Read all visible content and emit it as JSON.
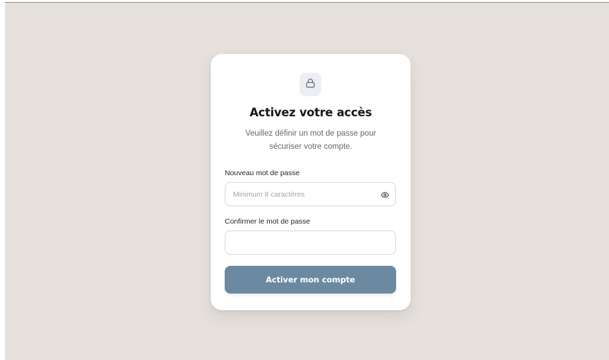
{
  "card": {
    "icon": "lock-icon",
    "title": "Activez votre accès",
    "subtitle": "Veuillez définir un mot de passe pour sécuriser votre compte."
  },
  "form": {
    "new_password": {
      "label": "Nouveau mot de passe",
      "placeholder": "Minimum 8 caractères",
      "value": "",
      "toggle_icon": "eye-icon"
    },
    "confirm_password": {
      "label": "Confirmer le mot de passe",
      "placeholder": "",
      "value": ""
    },
    "submit_label": "Activer mon compte"
  },
  "colors": {
    "background": "#e6e1dd",
    "card": "#ffffff",
    "button": "#6b8aa2",
    "title": "#1e1614",
    "icon_tile": "#edeef2"
  }
}
